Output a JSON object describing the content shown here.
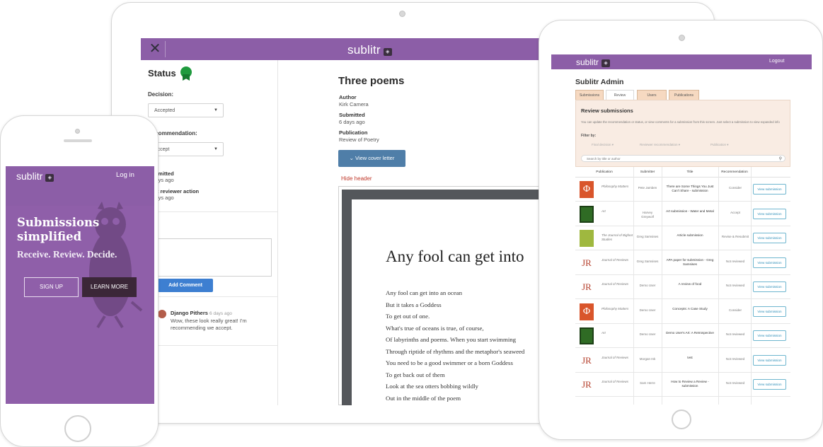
{
  "laptop": {
    "brand": "sublitr",
    "status_heading": "Status",
    "decision_label": "Decision:",
    "decision_value": "Accepted",
    "recommendation_label": "Recommendation:",
    "recommendation_value": "Accept",
    "submitted_label": "Submitted",
    "submitted_ago": "6 days ago",
    "last_reviewer_label": "Last reviewer action",
    "last_reviewer_ago": "6 days ago",
    "add_comment": "Add Comment",
    "comment_author": "Django Pithers",
    "comment_time": "6 days ago",
    "comment_text": "Wow, these look really great! I'm recommending we accept.",
    "doc_title": "Three poems",
    "author_label": "Author",
    "author_value": "Kirk Camera",
    "submitted_k": "Submitted",
    "submitted_v": "6 days ago",
    "publication_label": "Publication",
    "publication_value": "Review of Poetry",
    "cover_letter_btn": "View cover letter",
    "hide_header": "Hide header",
    "poem_title": "Any fool can get into",
    "poem_lines": [
      "Any fool can get into an ocean",
      "But it takes a Goddess",
      "To get out of one.",
      "What's true of oceans is true, of course,",
      "Of labyrinths and poems. When you start swimming",
      "Through riptide of rhythms and the metaphor's seaweed",
      "You need to be a good swimmer or a born Goddess",
      "To get back out of them",
      "Look at the sea otters bobbing wildly",
      "Out in the middle of the poem"
    ]
  },
  "phone": {
    "brand": "sublitr",
    "login": "Log in",
    "headline": "Submissions simplified",
    "tagline": "Receive. Review. Decide.",
    "signup": "SIGN UP",
    "learn_more": "LEARN MORE"
  },
  "admin": {
    "brand": "sublitr",
    "logout": "Logout",
    "title": "Sublitr Admin",
    "tabs": [
      "Submissions",
      "Review",
      "Users",
      "Publications"
    ],
    "active_tab": "Review",
    "panel_title": "Review submissions",
    "panel_desc": "You can update the recommendation or status, or view comments for a submission from this screen. Just select a submission to view expanded info",
    "filter_label": "Filter by:",
    "filters": [
      "Final decision",
      "Reviewer recommendation",
      "Publication"
    ],
    "search_placeholder": "Search by title or author",
    "columns": [
      "Publication",
      "Submitter",
      "Title",
      "Recommendation",
      ""
    ],
    "rows": [
      {
        "pub": "Philosophy Matters",
        "thumb": "phi",
        "submitter": "Pete Jamben",
        "title": "There are Some Things You Just Can't Share - submission",
        "rec": "Consider",
        "action": "View submission"
      },
      {
        "pub": "Art",
        "thumb": "art",
        "submitter": "Harvey Greywolf",
        "title": "Art submission - Water and Metal",
        "rec": "Accept",
        "action": "View submission"
      },
      {
        "pub": "The Journal of Bigfoot Studies",
        "thumb": "big",
        "submitter": "Greg Samsises",
        "title": "Article submission",
        "rec": "Revise & Resubmit",
        "action": "View submission"
      },
      {
        "pub": "Journal of Reviews",
        "thumb": "jr",
        "submitter": "Greg Samsises",
        "title": "APA paper for submission - Greg Samsises",
        "rec": "Not reviewed",
        "action": "View submission"
      },
      {
        "pub": "Journal of Reviews",
        "thumb": "jr",
        "submitter": "Demo User",
        "title": "A review of food",
        "rec": "Not reviewed",
        "action": "View submission"
      },
      {
        "pub": "Philosophy Matters",
        "thumb": "phi",
        "submitter": "Demo User",
        "title": "Concepts: A Case Study",
        "rec": "Consider",
        "action": "View submission"
      },
      {
        "pub": "Art",
        "thumb": "art",
        "submitter": "Demo User",
        "title": "Demo User's Art: A Retrospective",
        "rec": "Not reviewed",
        "action": "View submission"
      },
      {
        "pub": "Journal of Reviews",
        "thumb": "jr",
        "submitter": "Morgan Ink",
        "title": "test",
        "rec": "Not reviewed",
        "action": "View submission"
      },
      {
        "pub": "Journal of Reviews",
        "thumb": "jr",
        "submitter": "Sam Herre",
        "title": "How to Review a Review - submission",
        "rec": "Not reviewed",
        "action": "View submission"
      }
    ]
  },
  "colors": {
    "brand_purple": "#8c5ea7",
    "button_blue": "#3d7fd1",
    "accent_red": "#c0392b"
  }
}
